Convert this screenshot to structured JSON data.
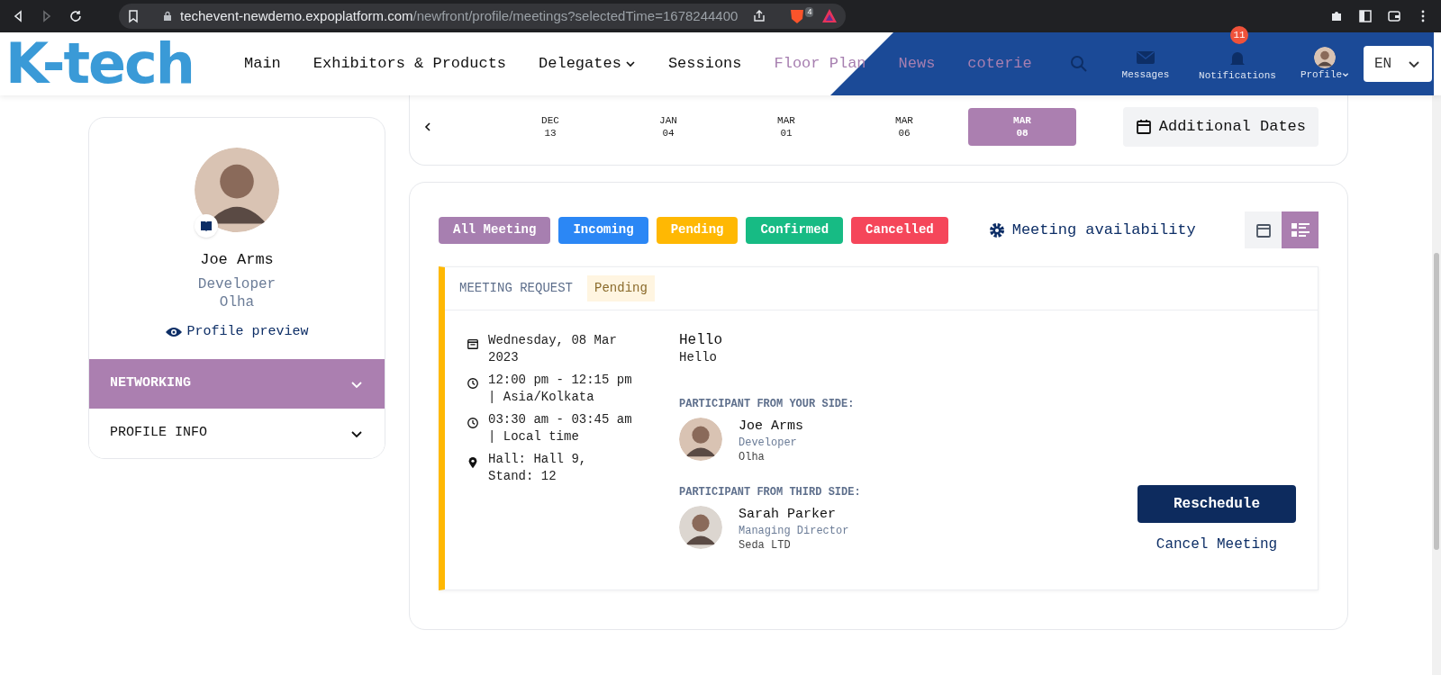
{
  "browser": {
    "url_domain": "techevent-newdemo.expoplatform.com",
    "url_path": "/newfront/profile/meetings?selectedTime=1678244400",
    "shield_badge": "4"
  },
  "header": {
    "logo": "K-tech",
    "nav": [
      {
        "label": "Main",
        "color": "#111111",
        "dropdown": false
      },
      {
        "label": "Exhibitors & Products",
        "color": "#111111",
        "dropdown": false
      },
      {
        "label": "Delegates",
        "color": "#111111",
        "dropdown": true
      },
      {
        "label": "Sessions",
        "color": "#111111",
        "dropdown": false
      },
      {
        "label": "Floor Plan",
        "color": "#a77fb0",
        "dropdown": false
      },
      {
        "label": "News",
        "color": "#a77fb0",
        "dropdown": false
      },
      {
        "label": "coterie",
        "color": "#a77fb0",
        "dropdown": false
      }
    ],
    "messages": "Messages",
    "notifications": "Notifications",
    "notification_count": "11",
    "profile": "Profile",
    "language": "EN"
  },
  "sidebar": {
    "name": "Joe Arms",
    "job_title": "Developer",
    "company": "Olha",
    "profile_preview": "Profile preview",
    "menu": [
      {
        "label": "NETWORKING",
        "selected": true
      },
      {
        "label": "PROFILE INFO",
        "selected": false
      }
    ]
  },
  "dates": [
    {
      "month": "DEC",
      "day": "13",
      "selected": false
    },
    {
      "month": "JAN",
      "day": "04",
      "selected": false
    },
    {
      "month": "MAR",
      "day": "01",
      "selected": false
    },
    {
      "month": "MAR",
      "day": "06",
      "selected": false
    },
    {
      "month": "MAR",
      "day": "08",
      "selected": true
    }
  ],
  "additional_dates": "Additional Dates",
  "filters": [
    {
      "label": "All Meeting",
      "color": "#a77fb0"
    },
    {
      "label": "Incoming",
      "color": "#2b87f5"
    },
    {
      "label": "Pending",
      "color": "#ffb803"
    },
    {
      "label": "Confirmed",
      "color": "#17bb84"
    },
    {
      "label": "Cancelled",
      "color": "#f5465a"
    }
  ],
  "meeting_availability": "Meeting availability",
  "views": [
    {
      "kind": "calendar",
      "selected": false
    },
    {
      "kind": "list",
      "selected": true
    }
  ],
  "meeting": {
    "type": "MEETING REQUEST",
    "status": "Pending",
    "details": [
      {
        "kind": "date",
        "text": "Wednesday, 08 Mar 2023"
      },
      {
        "kind": "time",
        "text": "12:00 pm - 12:15 pm | Asia/Kolkata"
      },
      {
        "kind": "time",
        "text": "03:30 am - 03:45 am | Local time"
      },
      {
        "kind": "location",
        "text": "Hall: Hall 9, Stand: 12"
      }
    ],
    "title": "Hello",
    "message": "Hello",
    "participant_groups": [
      {
        "heading": "PARTICIPANT FROM YOUR SIDE:",
        "name": "Joe Arms",
        "job_title": "Developer",
        "company": "Olha"
      },
      {
        "heading": "PARTICIPANT FROM THIRD SIDE:",
        "name": "Sarah Parker",
        "job_title": "Managing Director",
        "company": "Seda LTD"
      }
    ],
    "reschedule": "Reschedule",
    "cancel": "Cancel Meeting"
  }
}
